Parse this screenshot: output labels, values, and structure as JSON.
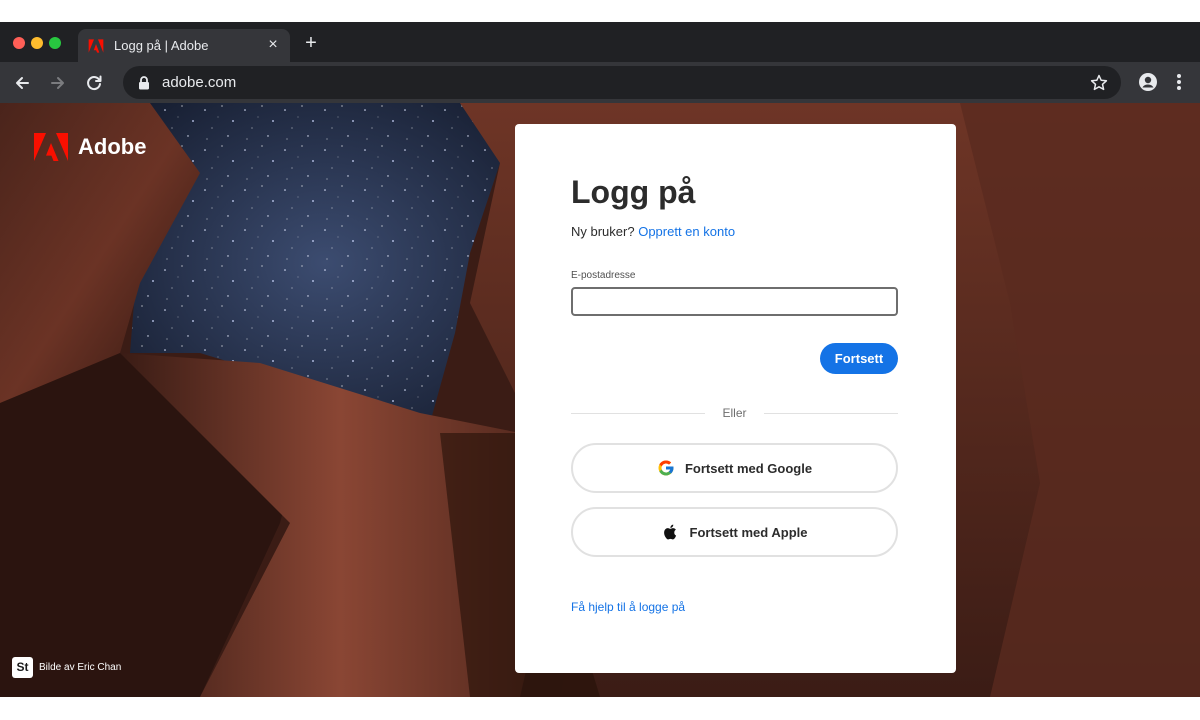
{
  "browser": {
    "tab_title": "Logg på | Adobe",
    "tab_close": "×",
    "new_tab": "+",
    "url": "adobe.com"
  },
  "page": {
    "brand": "Adobe",
    "photo_credit_badge": "St",
    "photo_credit": "Bilde av Eric Chan"
  },
  "card": {
    "title": "Logg på",
    "new_user_prompt": "Ny bruker?",
    "create_account_link": "Opprett en konto",
    "email_label": "E-postadresse",
    "email_value": "",
    "continue_button": "Fortsett",
    "or_text": "Eller",
    "google_button": "Fortsett med Google",
    "apple_button": "Fortsett med Apple",
    "help_link": "Få hjelp til å logge på"
  },
  "colors": {
    "accent": "#1473e6",
    "adobe_red": "#fa0f00",
    "browser_dark": "#202124",
    "browser_toolbar": "#35363a"
  },
  "icons": {
    "tab_favicon": "adobe-logo-icon",
    "back": "arrow-left-icon",
    "forward": "arrow-right-icon",
    "reload": "reload-icon",
    "lock": "lock-icon",
    "bookmark": "star-icon",
    "profile": "account-circle-icon",
    "menu": "kebab-menu-icon",
    "google": "google-g-icon",
    "apple": "apple-logo-icon"
  }
}
